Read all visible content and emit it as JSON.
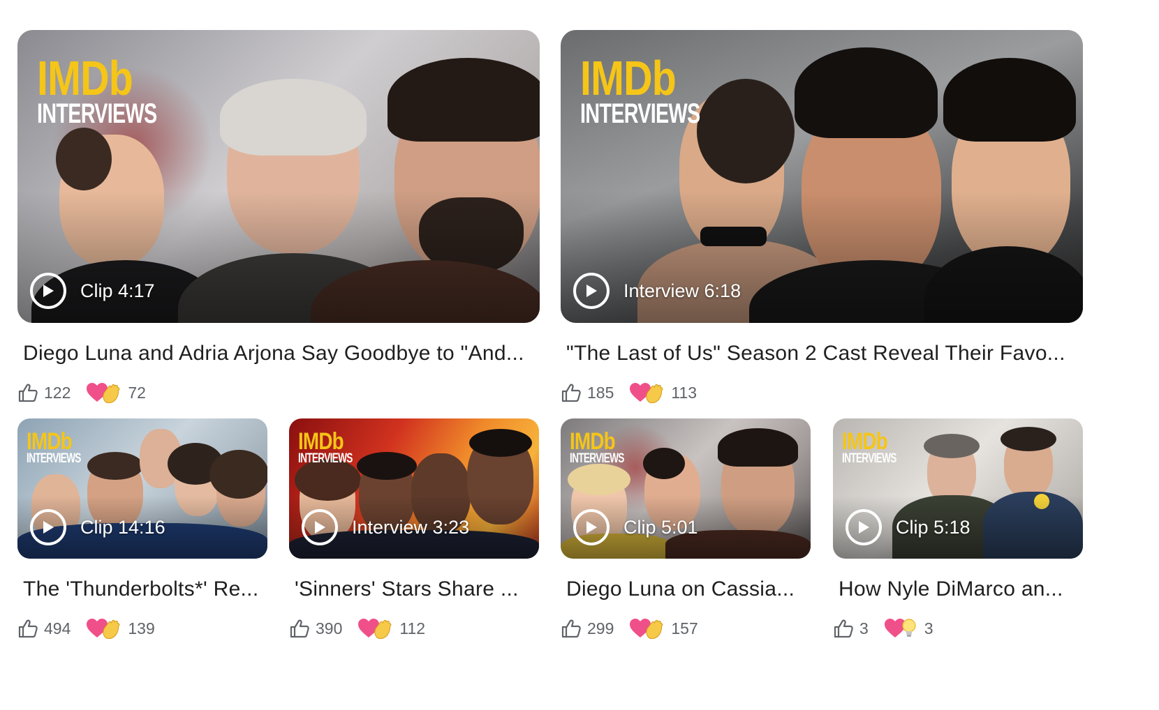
{
  "logo": {
    "top": "IMDb",
    "bottom": "INTERVIEWS"
  },
  "videos": [
    {
      "duration": "Clip 4:17",
      "title": "Diego Luna and Adria Arjona Say Goodbye to \"And...",
      "likes": "122",
      "reactions": "72",
      "reaction_icons": [
        "heart-icon",
        "clapping-hands-icon"
      ]
    },
    {
      "duration": "Interview 6:18",
      "title": "\"The Last of Us\" Season 2 Cast Reveal Their Favo...",
      "likes": "185",
      "reactions": "113",
      "reaction_icons": [
        "heart-icon",
        "clapping-hands-icon"
      ]
    },
    {
      "duration": "Clip 14:16",
      "title": "The 'Thunderbolts*' Re...",
      "likes": "494",
      "reactions": "139",
      "reaction_icons": [
        "heart-icon",
        "clapping-hands-icon"
      ]
    },
    {
      "duration": "Interview 3:23",
      "title": "'Sinners' Stars Share ...",
      "likes": "390",
      "reactions": "112",
      "reaction_icons": [
        "heart-icon",
        "clapping-hands-icon"
      ]
    },
    {
      "duration": "Clip 5:01",
      "title": "Diego Luna on Cassia...",
      "likes": "299",
      "reactions": "157",
      "reaction_icons": [
        "heart-icon",
        "clapping-hands-icon"
      ]
    },
    {
      "duration": "Clip 5:18",
      "title": "How Nyle DiMarco an...",
      "likes": "3",
      "reactions": "3",
      "reaction_icons": [
        "heart-icon",
        "lightbulb-icon"
      ]
    }
  ],
  "colors": {
    "imdb_yellow": "#f5c518",
    "heart_pink": "#f0508a",
    "text": "#1f1f1f",
    "meta": "#5f6368"
  }
}
